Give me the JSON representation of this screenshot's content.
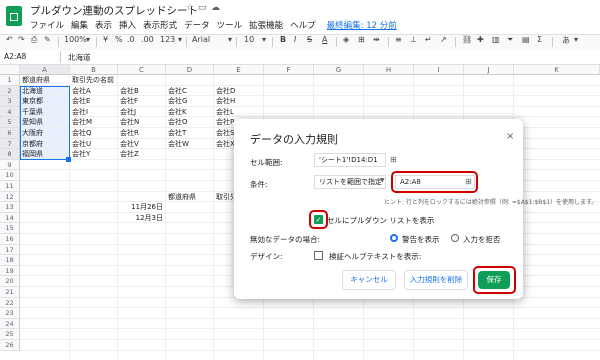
{
  "title": "プルダウン連動のスプレッドシート",
  "menu": [
    "ファイル",
    "編集",
    "表示",
    "挿入",
    "表示形式",
    "データ",
    "ツール",
    "拡張機能",
    "ヘルプ"
  ],
  "last_edit": "最終編集: 12 分前",
  "toolbar": {
    "zoom": "100%",
    "currency": "¥",
    "percent": "%",
    "dec1": ".0",
    "dec2": ".00",
    "format": "123",
    "font": "Arial",
    "size": "10",
    "bold": "B",
    "italic": "I",
    "strike": "S",
    "textcolor": "A",
    "more": "あ"
  },
  "namebox": "A2:A8",
  "formula": "北海道",
  "columns": [
    "A",
    "B",
    "C",
    "D",
    "E",
    "F",
    "G",
    "H",
    "I",
    "J",
    "K"
  ],
  "rows": [
    "1",
    "2",
    "3",
    "4",
    "5",
    "6",
    "7",
    "8",
    "9",
    "10",
    "11",
    "12",
    "13",
    "14",
    "15",
    "16",
    "17",
    "18",
    "19",
    "20",
    "21",
    "22",
    "23",
    "24",
    "25",
    "26"
  ],
  "table": {
    "header": [
      "都道府県",
      "取引先の名前"
    ],
    "data": [
      [
        "北海道",
        "会社A",
        "会社B",
        "会社C",
        "会社D"
      ],
      [
        "東京都",
        "会社E",
        "会社F",
        "会社G",
        "会社H"
      ],
      [
        "千葉県",
        "会社I",
        "会社J",
        "会社K",
        "会社L"
      ],
      [
        "愛知県",
        "会社M",
        "会社N",
        "会社O",
        "会社P"
      ],
      [
        "大阪府",
        "会社Q",
        "会社R",
        "会社T",
        "会社S"
      ],
      [
        "京都府",
        "会社U",
        "会社V",
        "会社W",
        "会社X"
      ],
      [
        "福岡県",
        "会社Y",
        "会社Z",
        "",
        ""
      ]
    ]
  },
  "side": {
    "h1": "都道府県",
    "h2": "取引先",
    "d1": "11月26日",
    "d2": "12月3日"
  },
  "dialog": {
    "title": "データの入力規則",
    "close": "×",
    "range_label": "セル範囲:",
    "range_value": "'シート1'!D14:D1",
    "criteria_label": "条件:",
    "criteria_select": "リストを範囲で指定",
    "criteria_value": "A2:A8",
    "hint": "ヒント: 行と列をロックするには絶対参照（例: =$A$1:$B$1）を使用します。",
    "show_dropdown": "セルにプルダウン リストを表示",
    "invalid_label": "無効なデータの場合:",
    "warn": "警告を表示",
    "reject": "入力を拒否",
    "design_label": "デザイン:",
    "help_text": "検証ヘルプテキストを表示:",
    "cancel": "キャンセル",
    "remove": "入力規則を削除",
    "save": "保存"
  }
}
